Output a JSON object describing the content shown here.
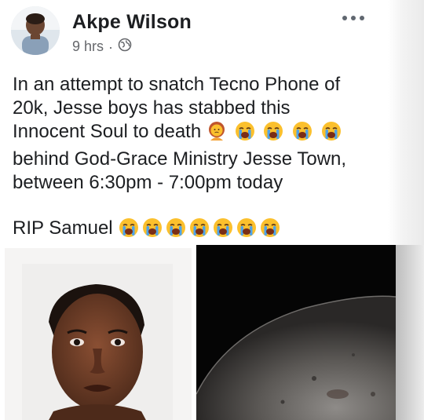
{
  "post": {
    "author": "Akpe Wilson",
    "timestamp": "9 hrs",
    "separator": "·",
    "privacy_icon": "globe-icon",
    "more_icon": "more-options-icon",
    "text_lines": [
      "In an attempt to snatch Tecno Phone of",
      "20k,  Jesse  boys has stabbed this",
      "Innocent Soul to death",
      "behind God-Grace Ministry Jesse Town,",
      "between 6:30pm - 7:00pm today"
    ],
    "closing_line": "RIP Samuel",
    "emojis": {
      "line3": [
        "woman-with-folded-hands-emoji",
        "crying-face-emoji",
        "crying-face-emoji",
        "crying-face-emoji",
        "crying-face-emoji"
      ],
      "closing": [
        "crying-face-emoji",
        "crying-face-emoji",
        "crying-face-emoji",
        "crying-face-emoji",
        "crying-face-emoji",
        "crying-face-emoji",
        "crying-face-emoji"
      ]
    },
    "photos": [
      "portrait-photo",
      "dark-ground-photo"
    ]
  },
  "colors": {
    "text": "#1c1e21",
    "meta": "#65676b",
    "emoji_yellow": "#fbc02d",
    "emoji_tear": "#4fa3e8"
  }
}
